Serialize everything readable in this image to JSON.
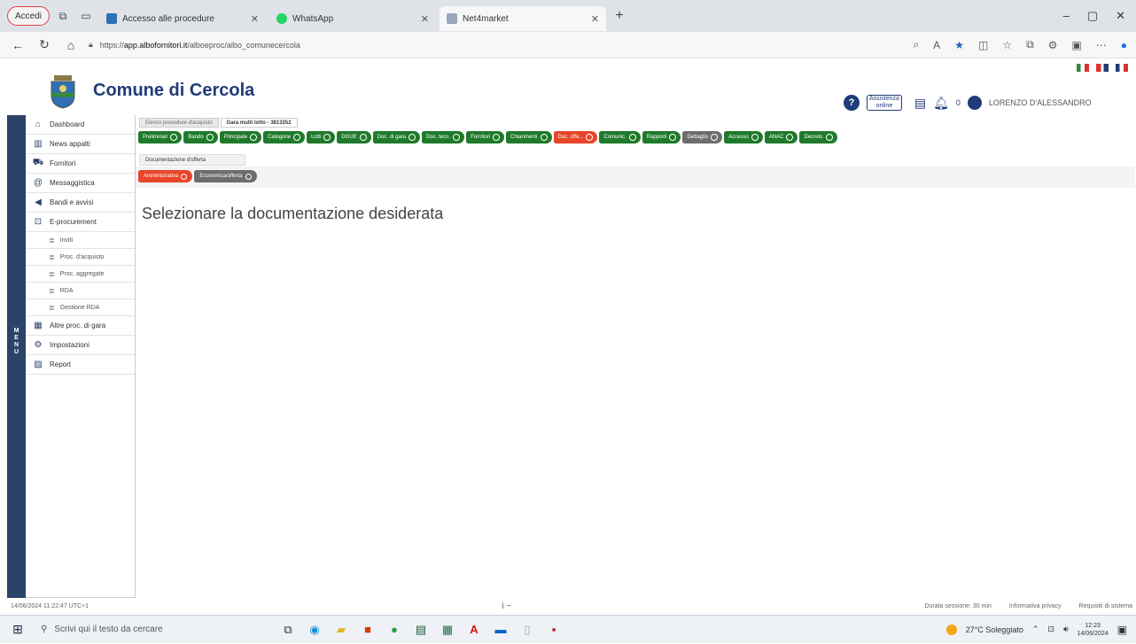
{
  "browser": {
    "profile_label": "Accedi",
    "tabs": [
      {
        "title": "Accesso alle procedure",
        "active": false,
        "fav_color": "#2f6fb3"
      },
      {
        "title": "WhatsApp",
        "active": false,
        "fav_color": "#25d366"
      },
      {
        "title": "Net4market",
        "active": true,
        "fav_color": "#9aa7b8"
      }
    ],
    "url_prefix": "https://",
    "url_host": "app.albofornitori.it",
    "url_path": "/alboeproc/albo_comunecercola",
    "window_controls": [
      "–",
      "▢",
      "✕"
    ]
  },
  "header": {
    "title": "Comune di Cercola",
    "assist_line1": "Assistenza",
    "assist_line2": "online",
    "notif_count": "0",
    "user_name": "LORENZO D'ALESSANDRO"
  },
  "menu_rail": "MENU",
  "sidebar": {
    "items": [
      {
        "label": "Dashboard",
        "icon": "home-icon"
      },
      {
        "label": "News appalti",
        "icon": "news-icon"
      },
      {
        "label": "Fornitori",
        "icon": "truck-icon"
      },
      {
        "label": "Messaggistica",
        "icon": "at-icon"
      },
      {
        "label": "Bandi e avvisi",
        "icon": "megaphone-icon"
      },
      {
        "label": "E-procurement",
        "icon": "cart-icon"
      }
    ],
    "subitems": [
      {
        "label": "Inviti"
      },
      {
        "label": "Proc. d'acquisto"
      },
      {
        "label": "Proc. aggregate"
      },
      {
        "label": "RDA"
      },
      {
        "label": "Gestione RDA"
      }
    ],
    "items_bottom": [
      {
        "label": "Altre proc. di gara",
        "icon": "building-icon"
      },
      {
        "label": "Impostazioni",
        "icon": "gear-icon"
      },
      {
        "label": "Report",
        "icon": "chart-icon"
      }
    ]
  },
  "breadcrumbs": [
    "Elenco procedure d'acquisto",
    "Gara multi lotto - 3813352"
  ],
  "steps": [
    {
      "label": "Preliminari",
      "state": "green"
    },
    {
      "label": "Bando",
      "state": "green"
    },
    {
      "label": "Principale",
      "state": "green"
    },
    {
      "label": "Categorie",
      "state": "green"
    },
    {
      "label": "Lotti",
      "state": "green"
    },
    {
      "label": "DGUE",
      "state": "green"
    },
    {
      "label": "Doc. di gara",
      "state": "green"
    },
    {
      "label": "Doc. tecn.",
      "state": "green"
    },
    {
      "label": "Fornitori",
      "state": "green"
    },
    {
      "label": "Chiarimenti",
      "state": "green"
    },
    {
      "label": "Doc. offe...",
      "state": "red"
    },
    {
      "label": "Comunic.",
      "state": "green"
    },
    {
      "label": "Rapporti",
      "state": "green"
    },
    {
      "label": "Dettaglio",
      "state": "grey"
    },
    {
      "label": "Accesso",
      "state": "green"
    },
    {
      "label": "ANAC",
      "state": "green"
    },
    {
      "label": "Decreto",
      "state": "green"
    }
  ],
  "doc_section_label": "Documentazione d'offerta",
  "subtabs": [
    {
      "label": "Amministrativa",
      "color": "#e8462a"
    },
    {
      "label": "Economica/offerta",
      "color": "#6d6d6d"
    }
  ],
  "main_message": "Selezionare la documentazione desiderata",
  "footer": {
    "left": "14/06/2024 11:22:47 UTC+1",
    "center": "i ~",
    "session": "Durata sessione: 30 min",
    "privacy": "Informativa privacy",
    "requirements": "Requisiti di sistema"
  },
  "taskbar": {
    "search_placeholder": "Scrivi qui il testo da cercare",
    "weather": "27°C  Soleggiato",
    "time": "12:23",
    "date": "14/06/2024"
  }
}
